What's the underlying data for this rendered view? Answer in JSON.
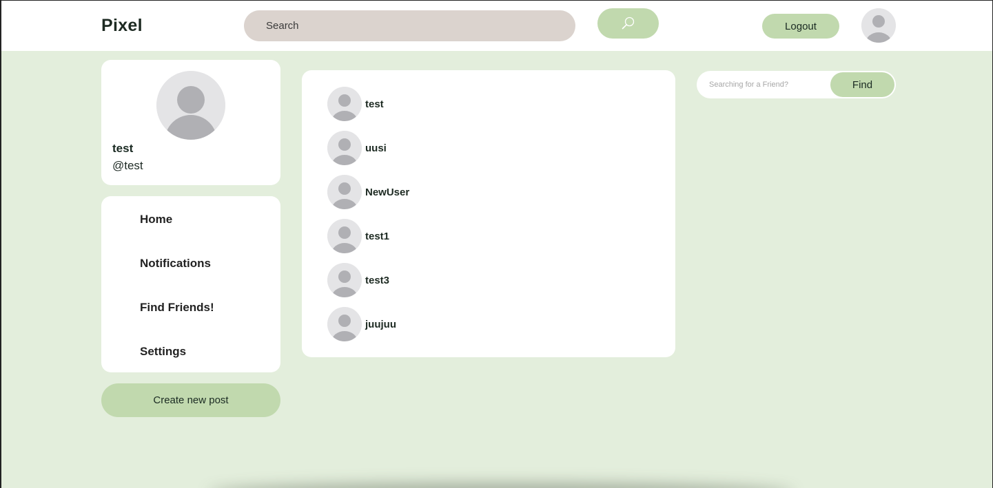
{
  "header": {
    "logo": "Pixel",
    "search_placeholder": "Search",
    "logout_label": "Logout"
  },
  "profile": {
    "name": "test",
    "handle": "@test"
  },
  "nav": {
    "items": [
      {
        "label": "Home"
      },
      {
        "label": "Notifications"
      },
      {
        "label": "Find Friends!"
      },
      {
        "label": "Settings"
      }
    ]
  },
  "create_post_label": "Create new post",
  "users": [
    {
      "name": "test"
    },
    {
      "name": "uusi"
    },
    {
      "name": "NewUser"
    },
    {
      "name": "test1"
    },
    {
      "name": "test3"
    },
    {
      "name": "juujuu"
    }
  ],
  "friend_search": {
    "placeholder": "Searching for a Friend?",
    "find_label": "Find"
  },
  "colors": {
    "page_bg": "#e3eedc",
    "accent": "#c1d9ae",
    "search_bg": "#dbd3ce",
    "avatar_bg": "#e4e4e6",
    "avatar_fg": "#b0b0b4"
  },
  "icons": {
    "search": "search-icon",
    "avatar": "user-avatar-icon"
  }
}
